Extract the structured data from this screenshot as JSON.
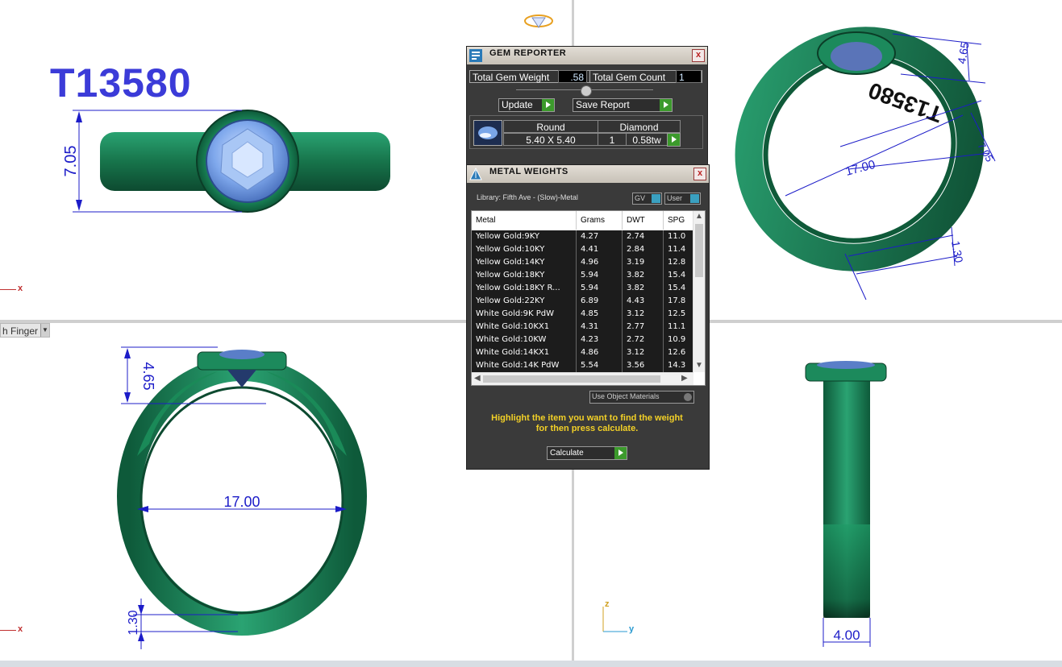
{
  "viewports": {
    "label_tab": "h Finger",
    "title_text": "T13580",
    "axes": {
      "x": "x",
      "y": "y",
      "z": "z"
    }
  },
  "dimensions": {
    "top_left": {
      "height": "7.05"
    },
    "top_right": {
      "top": "4.65",
      "width": "7.05",
      "inner": "17.00",
      "band": "1.30",
      "engraving": "T13580"
    },
    "bottom_left": {
      "top": "4.65",
      "inner": "17.00",
      "band": "1.30"
    },
    "bottom_right": {
      "width": "4.00"
    }
  },
  "gem_reporter": {
    "title": "GEM REPORTER",
    "close": "x",
    "total_gem_weight_label": "Total Gem Weight",
    "total_gem_weight": ".58",
    "total_gem_count_label": "Total Gem Count",
    "total_gem_count": "1",
    "update_label": "Update",
    "save_report_label": "Save Report",
    "gem": {
      "shape": "Round",
      "type": "Diamond",
      "size": "5.40 X 5.40",
      "count": "1",
      "weight": "0.58tw"
    }
  },
  "metal_weights": {
    "title": "METAL WEIGHTS",
    "close": "x",
    "library": "Library: Fifth Ave - (Slow)-Metal",
    "gv_label": "GV",
    "user_label": "User",
    "columns": [
      "Metal",
      "Grams",
      "DWT",
      "SPG"
    ],
    "rows": [
      [
        "Yellow Gold:9KY",
        "4.27",
        "2.74",
        "11.0"
      ],
      [
        "Yellow Gold:10KY",
        "4.41",
        "2.84",
        "11.4"
      ],
      [
        "Yellow Gold:14KY",
        "4.96",
        "3.19",
        "12.8"
      ],
      [
        "Yellow Gold:18KY",
        "5.94",
        "3.82",
        "15.4"
      ],
      [
        "Yellow Gold:18KY R...",
        "5.94",
        "3.82",
        "15.4"
      ],
      [
        "Yellow Gold:22KY",
        "6.89",
        "4.43",
        "17.8"
      ],
      [
        "White Gold:9K PdW",
        "4.85",
        "3.12",
        "12.5"
      ],
      [
        "White Gold:10KX1",
        "4.31",
        "2.77",
        "11.1"
      ],
      [
        "White Gold:10KW",
        "4.23",
        "2.72",
        "10.9"
      ],
      [
        "White Gold:14KX1",
        "4.86",
        "3.12",
        "12.6"
      ],
      [
        "White Gold:14K PdW",
        "5.54",
        "3.56",
        "14.3"
      ]
    ],
    "use_object_materials": "Use Object Materials",
    "hint_line1": "Highlight the item you want to find the weight",
    "hint_line2": "for then press calculate.",
    "calculate_label": "Calculate"
  },
  "colors": {
    "ring_green": "#1f8a5c",
    "gem_blue": "#7aa6e8",
    "dimension_blue": "#1c1cc8",
    "panel_bg": "#3a3a3a",
    "hint_yellow": "#f2d027"
  }
}
